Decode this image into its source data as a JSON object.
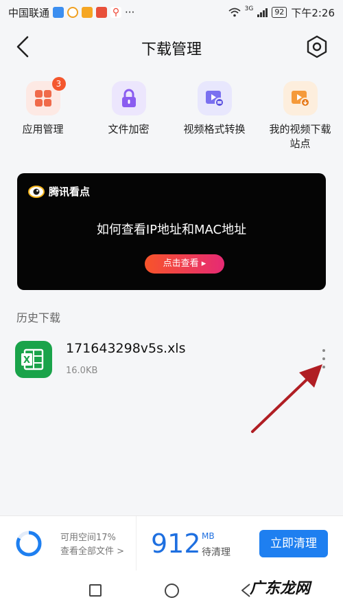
{
  "status_bar": {
    "carrier": "中国联通",
    "network": "3G",
    "battery": "92",
    "time": "下午2:26",
    "more": "···"
  },
  "header": {
    "title": "下载管理"
  },
  "tools": [
    {
      "label": "应用管理",
      "badge": "3",
      "icon": "app-grid-icon",
      "color": "#f06a4a"
    },
    {
      "label": "文件加密",
      "icon": "lock-icon",
      "color": "#8a5cf0"
    },
    {
      "label": "视频格式转换",
      "icon": "video-convert-icon",
      "color": "#7a70f0"
    },
    {
      "label": "我的视频下载站点",
      "icon": "video-download-icon",
      "color": "#f59a3a"
    }
  ],
  "banner": {
    "brand": "腾讯看点",
    "headline": "如何查看IP地址和MAC地址",
    "button": "点击查看 ▸"
  },
  "history": {
    "title": "历史下载",
    "files": [
      {
        "name": "171643298v5s.xls",
        "size": "16.0KB",
        "icon": "excel-file-icon"
      }
    ]
  },
  "storage": {
    "available_label": "可用空间17%",
    "available_fraction": 0.17,
    "view_all": "查看全部文件 >",
    "size_value": "912",
    "size_unit": "MB",
    "size_label": "待清理",
    "clean_button": "立即清理"
  },
  "watermark": "广东龙网",
  "colors": {
    "accent": "#1e7ff0",
    "arrow": "#b01e24"
  }
}
